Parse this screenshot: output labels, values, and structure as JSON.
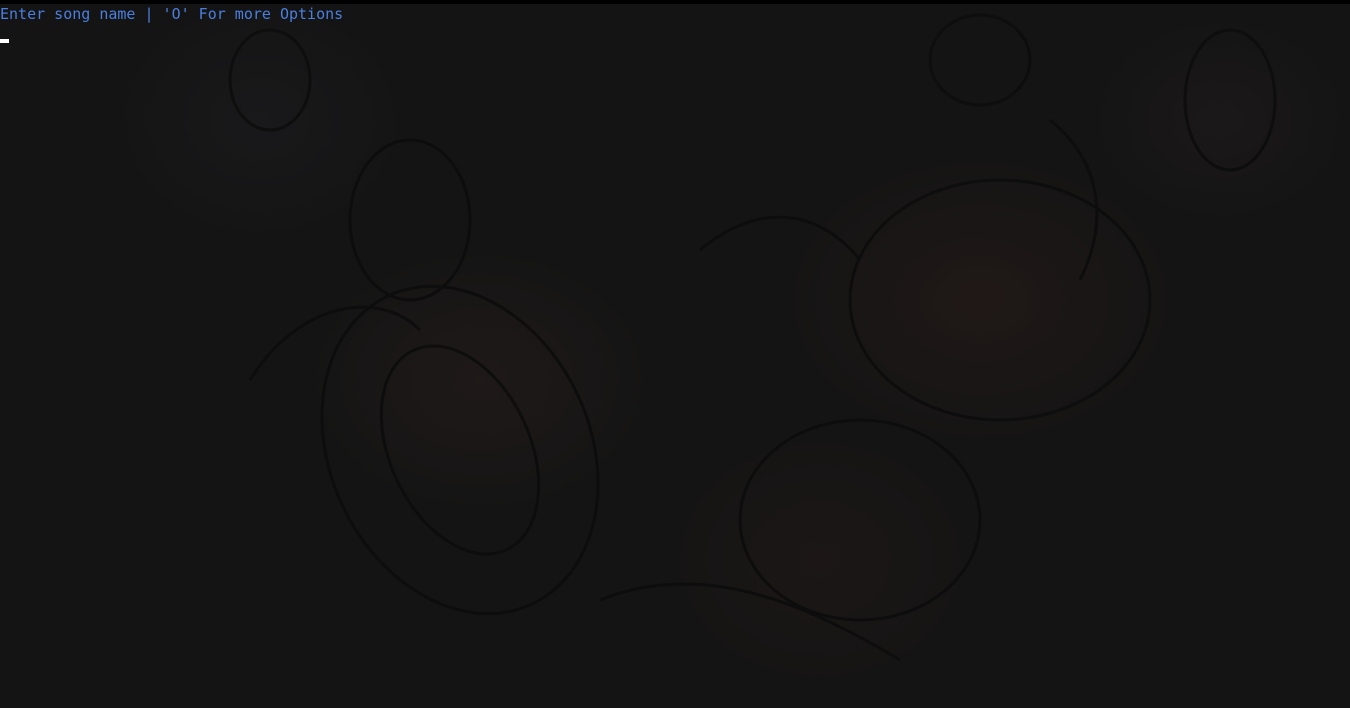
{
  "terminal": {
    "prompt": "Enter song name | 'O' For more Options",
    "prompt_color": "#4a7fe0",
    "background_color": "#141414",
    "cursor_color": "#ffffff"
  }
}
